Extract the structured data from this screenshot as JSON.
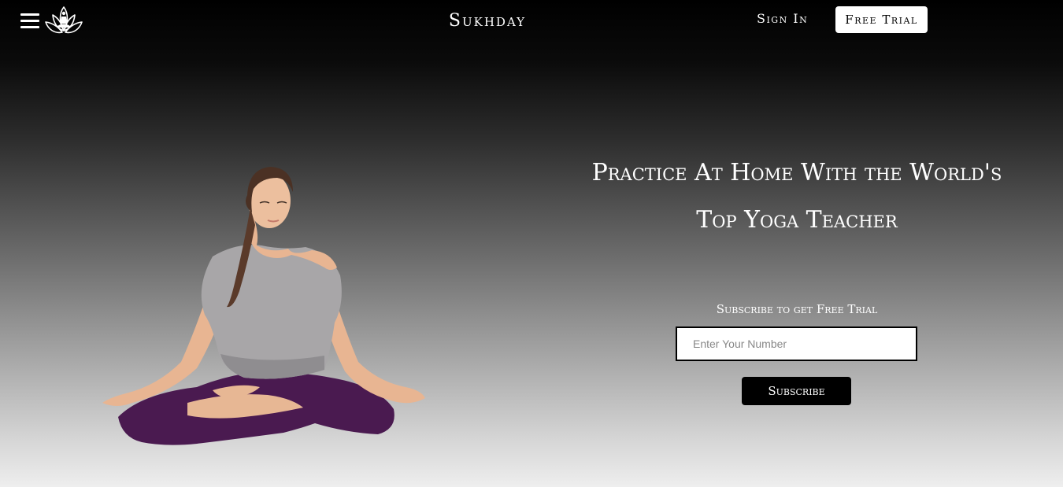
{
  "header": {
    "brand": "Sukhday",
    "sign_in": "Sign In",
    "free_trial": "Free Trial",
    "menu_icon": "hamburger-menu-icon",
    "logo_icon": "lotus-meditation-icon"
  },
  "hero": {
    "title_line1": "Practice At Home With the World's",
    "title_line2": "Top Yoga Teacher",
    "image": "woman-meditating-lotus-pose"
  },
  "subscribe": {
    "label": "Subscribe to get Free Trial",
    "input_placeholder": "Enter Your Number",
    "input_value": "",
    "button_label": "Subscribe"
  },
  "colors": {
    "topbar": "#000000",
    "background_bottom": "#eeeeee",
    "button": "#000000",
    "trial_button": "#ffffff"
  }
}
